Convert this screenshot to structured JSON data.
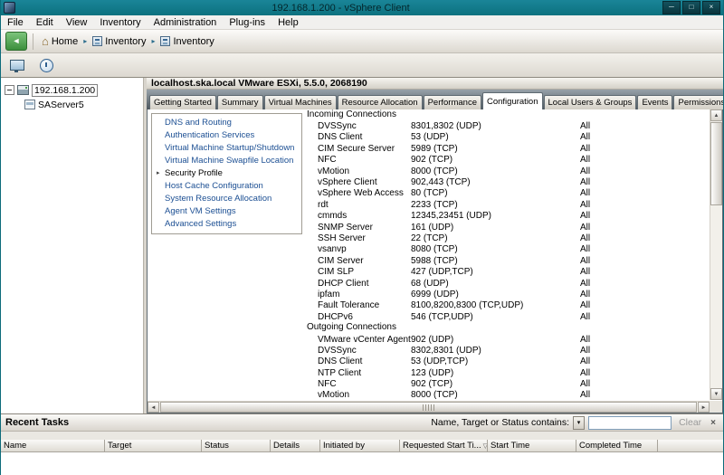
{
  "window": {
    "title": "192.168.1.200 - vSphere Client"
  },
  "menubar": {
    "items": [
      "File",
      "Edit",
      "View",
      "Inventory",
      "Administration",
      "Plug-ins",
      "Help"
    ]
  },
  "navbar": {
    "home_label": "Home",
    "crumb1": "Inventory",
    "crumb2": "Inventory"
  },
  "tree": {
    "root_label": "192.168.1.200",
    "child_label": "SAServer5"
  },
  "host_header": "localhost.ska.local VMware ESXi, 5.5.0, 2068190",
  "tabs": [
    {
      "label": "Getting Started",
      "active": false
    },
    {
      "label": "Summary",
      "active": false
    },
    {
      "label": "Virtual Machines",
      "active": false
    },
    {
      "label": "Resource Allocation",
      "active": false
    },
    {
      "label": "Performance",
      "active": false
    },
    {
      "label": "Configuration",
      "active": true
    },
    {
      "label": "Local Users & Groups",
      "active": false
    },
    {
      "label": "Events",
      "active": false
    },
    {
      "label": "Permissions",
      "active": false
    }
  ],
  "software_menu": {
    "items": [
      {
        "label": "DNS and Routing",
        "selected": false
      },
      {
        "label": "Authentication Services",
        "selected": false
      },
      {
        "label": "Virtual Machine Startup/Shutdown",
        "selected": false
      },
      {
        "label": "Virtual Machine Swapfile Location",
        "selected": false
      },
      {
        "label": "Security Profile",
        "selected": true
      },
      {
        "label": "Host Cache Configuration",
        "selected": false
      },
      {
        "label": "System Resource Allocation",
        "selected": false
      },
      {
        "label": "Agent VM Settings",
        "selected": false
      },
      {
        "label": "Advanced Settings",
        "selected": false
      }
    ]
  },
  "firewall": {
    "incoming_header": "Incoming Connections",
    "incoming": [
      {
        "name": "DVSSync",
        "ports": "8301,8302 (UDP)",
        "allowed": "All"
      },
      {
        "name": "DNS Client",
        "ports": "53 (UDP)",
        "allowed": "All"
      },
      {
        "name": "CIM Secure Server",
        "ports": "5989 (TCP)",
        "allowed": "All"
      },
      {
        "name": "NFC",
        "ports": "902 (TCP)",
        "allowed": "All"
      },
      {
        "name": "vMotion",
        "ports": "8000 (TCP)",
        "allowed": "All"
      },
      {
        "name": "vSphere Client",
        "ports": "902,443 (TCP)",
        "allowed": "All"
      },
      {
        "name": "vSphere Web Access",
        "ports": "80 (TCP)",
        "allowed": "All"
      },
      {
        "name": "rdt",
        "ports": "2233 (TCP)",
        "allowed": "All"
      },
      {
        "name": "cmmds",
        "ports": "12345,23451 (UDP)",
        "allowed": "All"
      },
      {
        "name": "SNMP Server",
        "ports": "161 (UDP)",
        "allowed": "All"
      },
      {
        "name": "SSH Server",
        "ports": "22 (TCP)",
        "allowed": "All"
      },
      {
        "name": "vsanvp",
        "ports": "8080 (TCP)",
        "allowed": "All"
      },
      {
        "name": "CIM Server",
        "ports": "5988 (TCP)",
        "allowed": "All"
      },
      {
        "name": "CIM SLP",
        "ports": "427 (UDP,TCP)",
        "allowed": "All"
      },
      {
        "name": "DHCP Client",
        "ports": "68 (UDP)",
        "allowed": "All"
      },
      {
        "name": "ipfam",
        "ports": "6999 (UDP)",
        "allowed": "All"
      },
      {
        "name": "Fault Tolerance",
        "ports": "8100,8200,8300 (TCP,UDP)",
        "allowed": "All"
      },
      {
        "name": "DHCPv6",
        "ports": "546 (TCP,UDP)",
        "allowed": "All"
      }
    ],
    "outgoing_header": "Outgoing Connections",
    "outgoing": [
      {
        "name": "VMware vCenter Agent",
        "ports": "902 (UDP)",
        "allowed": "All"
      },
      {
        "name": "DVSSync",
        "ports": "8302,8301 (UDP)",
        "allowed": "All"
      },
      {
        "name": "DNS Client",
        "ports": "53 (UDP,TCP)",
        "allowed": "All"
      },
      {
        "name": "NTP Client",
        "ports": "123 (UDP)",
        "allowed": "All"
      },
      {
        "name": "NFC",
        "ports": "902 (TCP)",
        "allowed": "All"
      },
      {
        "name": "vMotion",
        "ports": "8000 (TCP)",
        "allowed": "All"
      }
    ]
  },
  "recent_tasks": {
    "title": "Recent Tasks",
    "filter_label": "Name, Target or Status contains:",
    "filter_value": "",
    "clear_label": "Clear",
    "columns": [
      {
        "label": "Name"
      },
      {
        "label": "Target"
      },
      {
        "label": "Status"
      },
      {
        "label": "Details"
      },
      {
        "label": "Initiated by"
      },
      {
        "label": "Requested Start Ti...",
        "sort": "▽"
      },
      {
        "label": "Start Time"
      },
      {
        "label": "Completed Time"
      }
    ]
  },
  "icons": {
    "minimize": "─",
    "maximize": "□",
    "close": "×",
    "back_arrow": "◄",
    "home": "⌂",
    "crumb_arrow": "▸",
    "scroll_up": "▲",
    "scroll_down": "▼",
    "scroll_left": "◄",
    "scroll_right": "►",
    "dropdown_arrow": "▾",
    "panel_close": "×",
    "selected_marker": "▸"
  },
  "colors": {
    "titlebar_teal": "#0e7c8c",
    "link_blue": "#1c4f93",
    "back_button_green": "#4aa14a"
  }
}
